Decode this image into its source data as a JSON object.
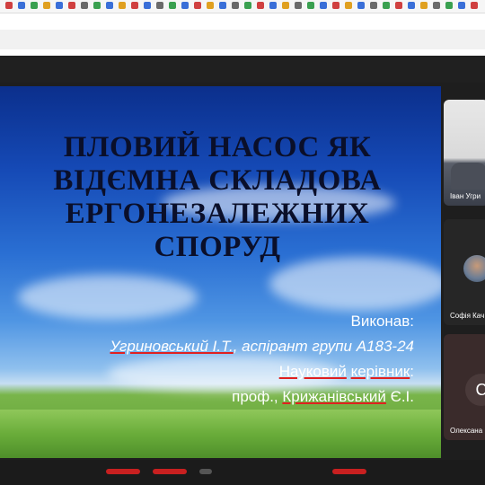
{
  "slide": {
    "title_lines": [
      "ПЛОВИЙ НАСОС ЯК",
      "ВІДЄМНА СКЛАДОВА",
      "ЕРГОНЕЗАЛЕЖНИХ",
      "СПОРУД"
    ],
    "performer_label": "Виконав:",
    "performer_name": "Угриновський І.Т.",
    "performer_rest": ", аспірант групи А183-24",
    "advisor_label_1": "Науковий",
    "advisor_label_2": "керівник",
    "advisor_colon": ":",
    "advisor_title": "проф., ",
    "advisor_name": "Крижанівський",
    "advisor_initials": " Є.І."
  },
  "participants": [
    {
      "name": "Іван Угри"
    },
    {
      "name": "Софія Кач"
    },
    {
      "name": "Олексана"
    }
  ],
  "icons": {
    "mic_off": "C"
  }
}
